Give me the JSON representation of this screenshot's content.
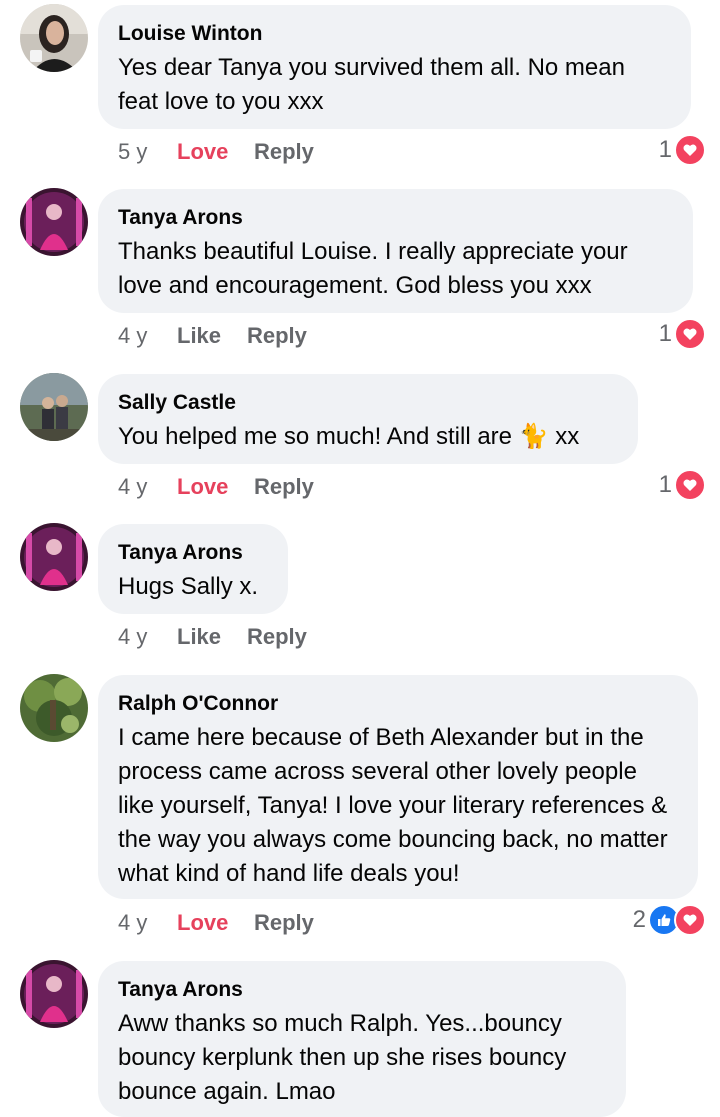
{
  "comments": [
    {
      "author": "Louise Winton",
      "text": "Yes dear Tanya you survived them all.   No mean feat love to you xxx",
      "time": "5 y",
      "react_label": "Love",
      "reply_label": "Reply",
      "reaction_count": "1",
      "reaction_icons": [
        "love-icon"
      ]
    },
    {
      "author": "Tanya Arons",
      "text": "Thanks beautiful Louise.  I really appreciate your love and encouragement.  God bless you xxx",
      "time": "4 y",
      "react_label": "Like",
      "reply_label": "Reply",
      "reaction_count": "1",
      "reaction_icons": [
        "love-icon"
      ]
    },
    {
      "author": "Sally Castle",
      "text_before": "You helped me so much! And still are ",
      "emoji": "🐈",
      "text_after": " xx",
      "time": "4 y",
      "react_label": "Love",
      "reply_label": "Reply",
      "reaction_count": "1",
      "reaction_icons": [
        "love-icon"
      ]
    },
    {
      "author": "Tanya Arons",
      "text": "Hugs Sally x.",
      "time": "4 y",
      "react_label": "Like",
      "reply_label": "Reply"
    },
    {
      "author": "Ralph O'Connor",
      "text": "I came here because of Beth Alexander but in the process came across several other lovely people like yourself, Tanya!   I love your literary references & the way you always come bouncing back, no matter what kind of hand life deals you!",
      "time": "4 y",
      "react_label": "Love",
      "reply_label": "Reply",
      "reaction_count": "2",
      "reaction_icons": [
        "like-icon",
        "love-icon"
      ]
    },
    {
      "author": "Tanya Arons",
      "text": "Aww thanks so much Ralph.  Yes...bouncy bouncy kerplunk then up she rises bouncy bounce again.  Lmao"
    }
  ],
  "colors": {
    "bubble": "#f0f2f5",
    "love_text": "#e6415c",
    "love_reaction": "#f3425f",
    "like_reaction": "#1877f2",
    "meta_text": "#65676b"
  }
}
